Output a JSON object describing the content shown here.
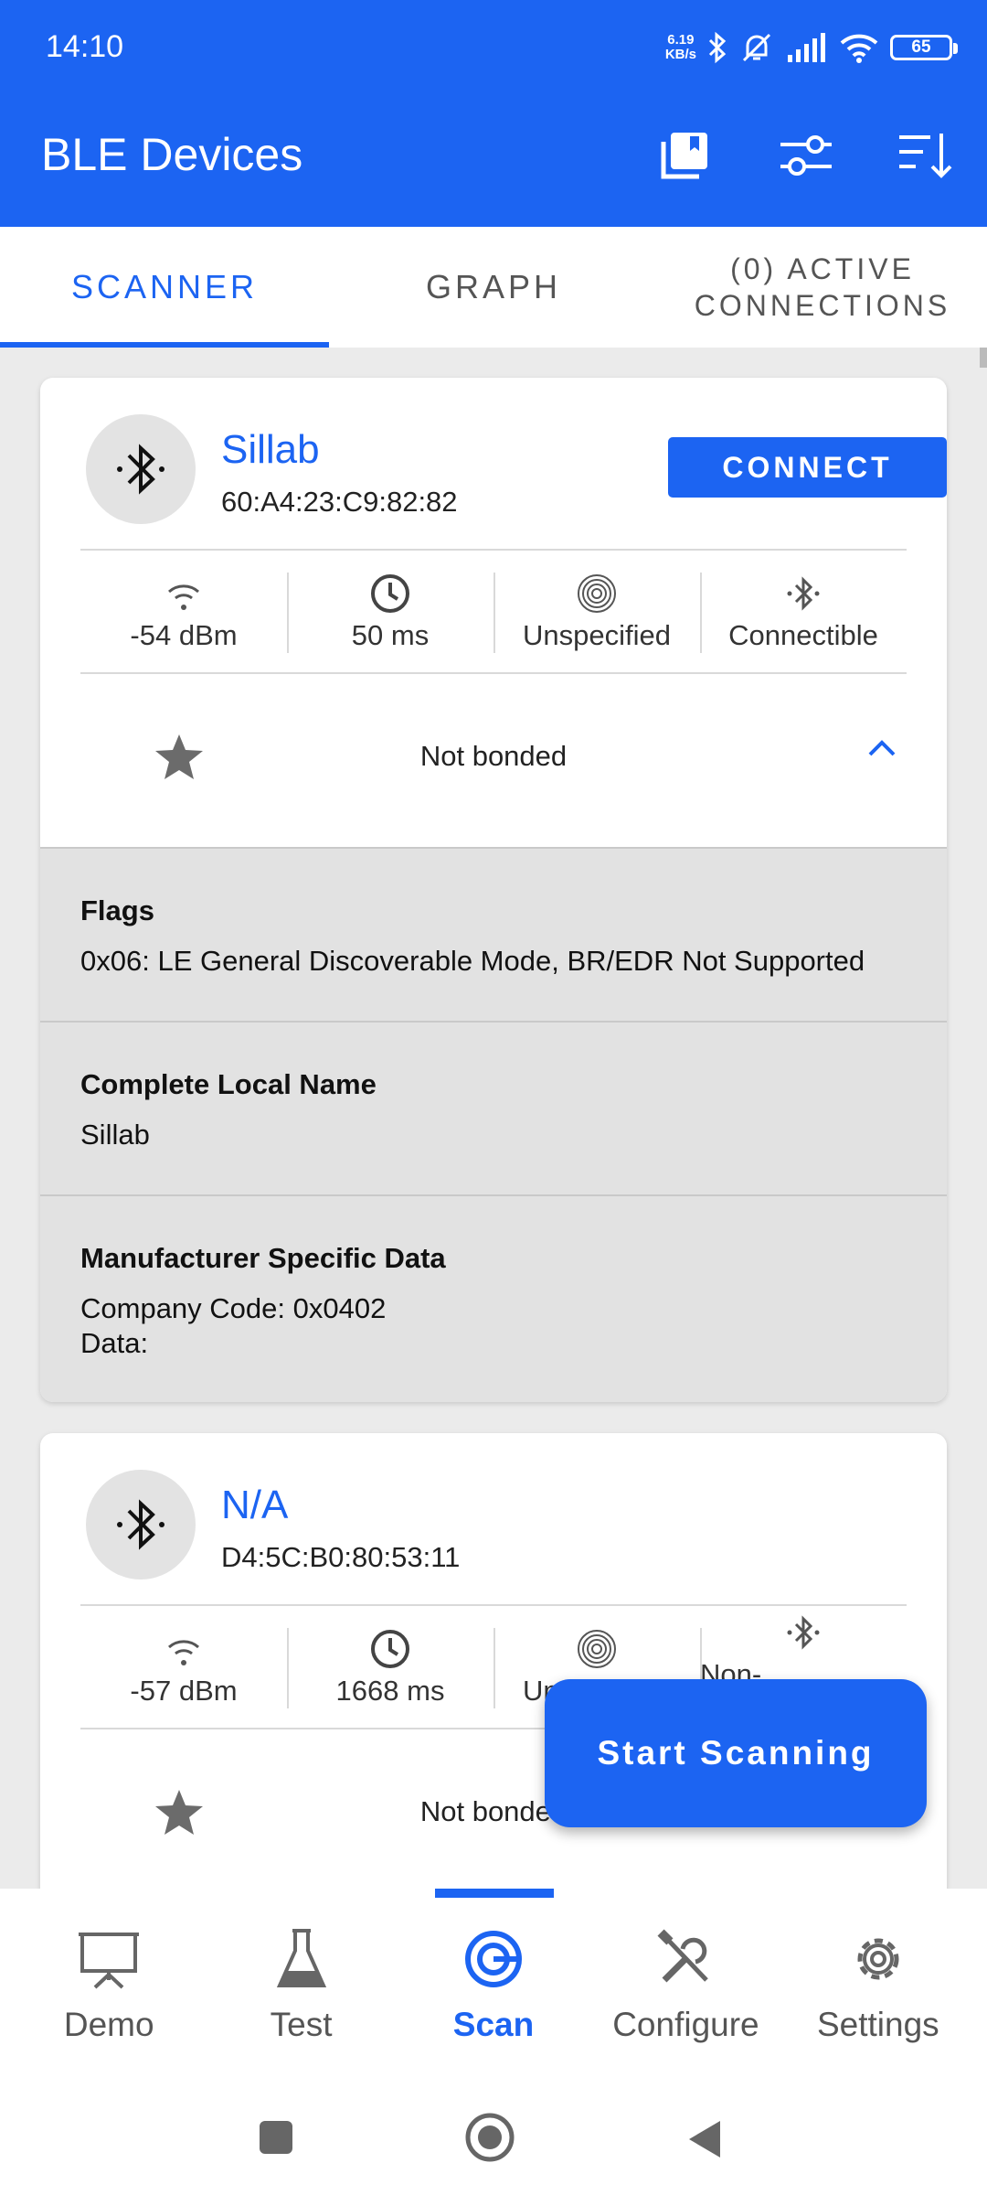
{
  "status_bar": {
    "time": "14:10",
    "net_speed_value": "6.19",
    "net_speed_unit": "KB/s",
    "battery": "65"
  },
  "app_bar": {
    "title": "BLE Devices",
    "actions": [
      "bookmarks-icon",
      "filter-icon",
      "sort-icon"
    ]
  },
  "tabs": [
    {
      "label": "SCANNER",
      "active": true
    },
    {
      "label": "GRAPH",
      "active": false
    },
    {
      "label": "(0) ACTIVE CONNECTIONS",
      "active": false
    }
  ],
  "devices": [
    {
      "name": "Sillab",
      "address": "60:A4:23:C9:82:82",
      "connect_label": "CONNECT",
      "rssi": "-54 dBm",
      "interval": "50 ms",
      "beacon_type": "Unspecified",
      "connectable": "Connectible",
      "bond_status": "Not bonded",
      "expanded": true,
      "advertisement": [
        {
          "title": "Flags",
          "value": "0x06: LE General Discoverable Mode, BR/EDR Not Supported"
        },
        {
          "title": "Complete Local Name",
          "value": "Sillab"
        },
        {
          "title": "Manufacturer Specific Data",
          "value": "Company Code: 0x0402\nData:"
        }
      ]
    },
    {
      "name": "N/A",
      "address": "D4:5C:B0:80:53:11",
      "rssi": "-57 dBm",
      "interval": "1668 ms",
      "beacon_type": "Unspecified",
      "connectable": "Non-Connectible",
      "bond_status": "Not bonded",
      "expanded": false
    }
  ],
  "fab": {
    "label": "Start Scanning"
  },
  "bottom_nav": [
    {
      "label": "Demo",
      "icon": "presentation-icon",
      "active": false
    },
    {
      "label": "Test",
      "icon": "flask-icon",
      "active": false
    },
    {
      "label": "Scan",
      "icon": "scan-target-icon",
      "active": true
    },
    {
      "label": "Configure",
      "icon": "tools-icon",
      "active": false
    },
    {
      "label": "Settings",
      "icon": "gear-icon",
      "active": false
    }
  ],
  "colors": {
    "primary": "#1c64f2",
    "background": "#ebebeb",
    "adv_background": "#e2e2e2"
  }
}
